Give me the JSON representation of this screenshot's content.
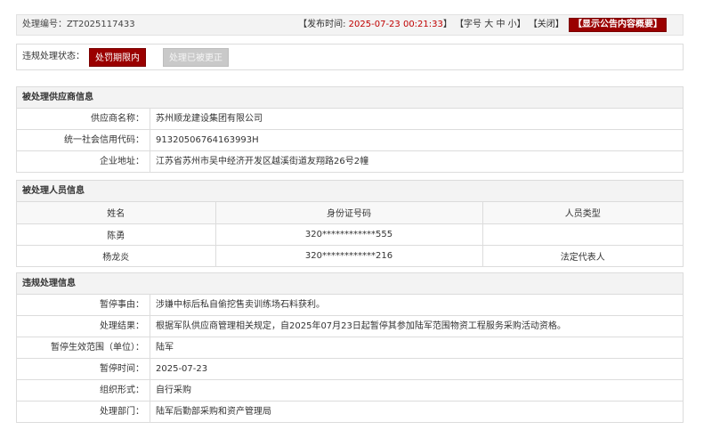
{
  "header": {
    "code_label": "处理编号：",
    "code_value": "ZT2025117433",
    "publish_prefix": "【发布时间: ",
    "publish_time": "2025-07-23 00:21:33",
    "publish_suffix": "】",
    "font_prefix": "【字号",
    "font_large": "大",
    "font_medium": "中",
    "font_small": "小",
    "font_suffix": "】",
    "close_label": "【关闭】",
    "show_button": "【显示公告内容概要】"
  },
  "status": {
    "label": "违规处理状态：",
    "active_button": "处罚期限内",
    "inactive_button": "处理已被更正"
  },
  "supplier": {
    "title": "被处理供应商信息",
    "rows": [
      {
        "k": "供应商名称：",
        "v": "苏州顺龙建设集团有限公司"
      },
      {
        "k": "统一社会信用代码：",
        "v": "91320506764163993H"
      },
      {
        "k": "企业地址：",
        "v": "江苏省苏州市吴中经济开发区越溪街道友翔路26号2幢"
      }
    ]
  },
  "persons": {
    "title": "被处理人员信息",
    "headers": [
      "姓名",
      "身份证号码",
      "人员类型"
    ],
    "rows": [
      [
        "陈勇",
        "320************555",
        ""
      ],
      [
        "杨龙炎",
        "320************216",
        "法定代表人"
      ]
    ]
  },
  "violation": {
    "title": "违规处理信息",
    "rows": [
      {
        "k": "暂停事由：",
        "v": "涉嫌中标后私自偷挖售卖训练场石料获利。"
      },
      {
        "k": "处理结果：",
        "v": "根据军队供应商管理相关规定，自2025年07月23日起暂停其参加陆军范围物资工程服务采购活动资格。"
      },
      {
        "k": "暂停生效范围（单位）：",
        "v": "陆军"
      },
      {
        "k": "暂停时间：",
        "v": "2025-07-23"
      },
      {
        "k": "组织形式：",
        "v": "自行采购"
      },
      {
        "k": "处理部门：",
        "v": "陆军后勤部采购和资产管理局"
      }
    ]
  },
  "colors": {
    "accent": "#9a0000",
    "time": "#c00000"
  }
}
